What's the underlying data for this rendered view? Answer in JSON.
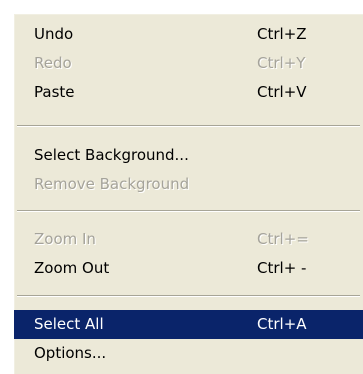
{
  "menu": {
    "items": [
      {
        "label": "Undo",
        "shortcut": "Ctrl+Z",
        "enabled": true
      },
      {
        "label": "Redo",
        "shortcut": "Ctrl+Y",
        "enabled": false
      },
      {
        "label": "Paste",
        "shortcut": "Ctrl+V",
        "enabled": true
      },
      {
        "label": "Select Background...",
        "shortcut": "",
        "enabled": true
      },
      {
        "label": "Remove Background",
        "shortcut": "",
        "enabled": false
      },
      {
        "label": "Zoom In",
        "shortcut": "Ctrl+=",
        "enabled": false
      },
      {
        "label": "Zoom Out",
        "shortcut": "Ctrl+ -",
        "enabled": true
      },
      {
        "label": "Select All",
        "shortcut": "Ctrl+A",
        "enabled": true,
        "highlighted": true
      },
      {
        "label": "Options...",
        "shortcut": "",
        "enabled": true
      }
    ],
    "colors": {
      "background": "#ece9d8",
      "highlight": "#0a246a",
      "disabled_text": "#a5a39a"
    }
  }
}
